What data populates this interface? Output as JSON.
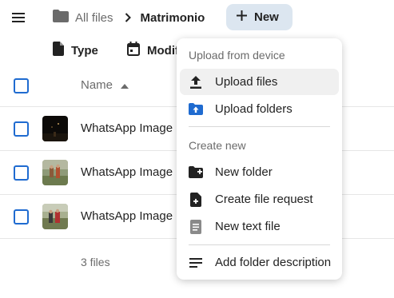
{
  "breadcrumb": {
    "root_label": "All files",
    "current_label": "Matrimonio"
  },
  "new_button": {
    "label": "New"
  },
  "filters": {
    "type_label": "Type",
    "modified_label": "Modified"
  },
  "table": {
    "name_header": "Name",
    "rows": [
      {
        "name": "WhatsApp Image"
      },
      {
        "name": "WhatsApp Image"
      },
      {
        "name": "WhatsApp Image"
      }
    ],
    "summary": "3 files"
  },
  "new_menu": {
    "section_upload": "Upload from device",
    "upload_files": "Upload files",
    "upload_folders": "Upload folders",
    "section_create": "Create new",
    "new_folder": "New folder",
    "create_file_request": "Create file request",
    "new_text_file": "New text file",
    "add_folder_description": "Add folder description"
  },
  "colors": {
    "accent": "#1f6bd0",
    "new_button_bg": "#dce6f0",
    "muted_text": "#6b6b6b"
  }
}
